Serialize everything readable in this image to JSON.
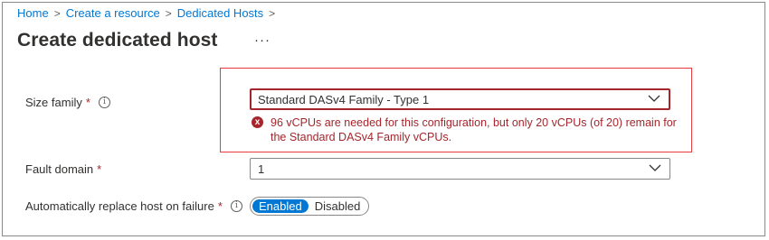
{
  "breadcrumb": {
    "items": [
      "Home",
      "Create a resource",
      "Dedicated Hosts"
    ],
    "separator": ">"
  },
  "page": {
    "title": "Create dedicated host",
    "more": "···"
  },
  "size_family": {
    "label": "Size family",
    "required_mark": "*",
    "info": "i",
    "value": "Standard DASv4 Family - Type 1",
    "error": "96 vCPUs are needed for this configuration, but only 20 vCPUs (of 20) remain for the Standard DASv4 Family vCPUs.",
    "error_icon": "x"
  },
  "fault_domain": {
    "label": "Fault domain",
    "required_mark": "*",
    "value": "1"
  },
  "auto_replace": {
    "label": "Automatically replace host on failure",
    "required_mark": "*",
    "info": "i",
    "options": [
      "Enabled",
      "Disabled"
    ],
    "selected": "Enabled"
  },
  "colors": {
    "accent": "#0078d4",
    "error": "#a4262c",
    "error_outline": "#e9393f"
  },
  "icons": {
    "chevron": "chevron-down-icon",
    "info": "info-icon",
    "error": "error-circle-icon"
  }
}
